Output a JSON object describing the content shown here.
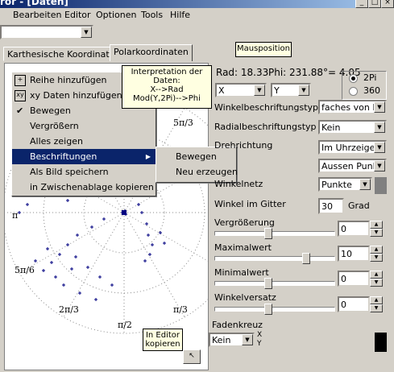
{
  "window": {
    "title": "ror - [Daten]"
  },
  "menu": [
    "Bearbeiten",
    "Editor",
    "Optionen",
    "Tools",
    "Hilfe"
  ],
  "tabs": {
    "cartesian": "Karthesische Koordinaten",
    "polar": "Polarkoordinaten"
  },
  "mouse_tooltip": "Mausposition",
  "interp_tooltip": {
    "line1": "Interpretation der",
    "line2": "Daten:",
    "line3": "X-->Rad",
    "line4": "Mod(Y,2Pi)-->Phi"
  },
  "readout": {
    "rad": "Rad: 18.33",
    "phi": "Phi: 231.88°= 4.05"
  },
  "xy_combo": {
    "x": "X",
    "y": "Y"
  },
  "radio": {
    "opt1": "2Pi",
    "opt2": "360"
  },
  "context_menu": {
    "items": [
      "Reihe hinzufügen",
      "xy Daten hinzufügen",
      "Bewegen",
      "Vergrößern",
      "Alles zeigen",
      "Beschriftungen",
      "Als Bild speichern",
      "in Zwischenablage kopieren"
    ],
    "submenu": [
      "Bewegen",
      "Neu erzeugen"
    ]
  },
  "settings": {
    "winkel_typ_label": "Winkelbeschriftungstyp",
    "winkel_typ_value": "faches von P",
    "radial_typ_label": "Radialbeschriftungstyp",
    "radial_typ_value": "Kein",
    "drehrichtung_label": "Drehrichtung",
    "drehrichtung_value": "Im Uhrzeigers",
    "label4_value": "Aussen Punk",
    "winkelnetz_label": "Winkelnetz",
    "winkelnetz_value": "Punkte",
    "gitter_label": "Winkel im Gitter",
    "gitter_value": "30",
    "gitter_unit": "Grad",
    "vergroesserung_label": "Vergrößerung",
    "vergroesserung_value": "0",
    "maximal_label": "Maximalwert",
    "maximal_value": "10",
    "minimal_label": "Minimalwert",
    "minimal_value": "0",
    "versatz_label": "Winkelversatz",
    "versatz_value": "0",
    "faden_label": "Fadenkreuz",
    "faden_value": "Kein",
    "faden_x": "X",
    "faden_y": "Y"
  },
  "editor_tooltip": {
    "line1": "In Editor",
    "line2": "kopieren"
  },
  "plot_labels": {
    "l1": "5π/3",
    "l2": "π",
    "l3": "5π/6",
    "l4": "2π/3",
    "l5": "π/3",
    "l6": "π/2"
  },
  "plot_color": "#000080"
}
